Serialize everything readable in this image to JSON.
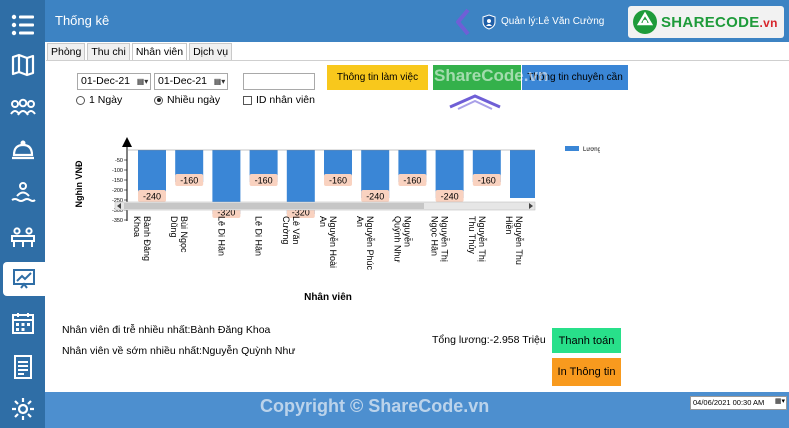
{
  "header": {
    "title": "Thống kê",
    "user_label": "Quản lý:Lê Văn Cường",
    "logo_text": "SHARECODE",
    "logo_suffix": ".vn"
  },
  "tabs": [
    {
      "label": "Phòng"
    },
    {
      "label": "Thu chi"
    },
    {
      "label": "Nhân viên"
    },
    {
      "label": "Dịch vụ"
    }
  ],
  "filters": {
    "date_from": "01-Dec-21",
    "date_to": "01-Dec-21",
    "id_value": "",
    "radio_one_day": "1 Ngày",
    "radio_many_days": "Nhiều ngày",
    "check_id": "ID nhân viên"
  },
  "buttons": {
    "work_info": "Thông tin làm việc",
    "green_btn": "Thông tin lương",
    "attendance": "Thông tin chuyên cần",
    "pay": "Thanh toán",
    "print": "In Thông tin"
  },
  "watermark": "ShareCode.vn",
  "notes": {
    "late": "Nhân viên đi trễ nhiều nhất:Bành Đăng Khoa",
    "early": "Nhân viên về sớm nhiều nhất:Nguyễn Quỳnh Như",
    "total": "Tổng lương:-2.958 Triệu"
  },
  "footer": {
    "copyright": "Copyright © ShareCode.vn",
    "datetime": "04/06/2021 00:30 AM"
  },
  "colors": {
    "sidebar": "#2f6ea6",
    "header": "#3d83c3",
    "bar": "#3a86d6",
    "label_bg": "#f9d2c0"
  },
  "chart_data": {
    "type": "bar",
    "xlabel": "Nhân viên",
    "ylabel": "Nghìn VNĐ",
    "legend": "Lương",
    "legend_position": "top-right",
    "yticks": [
      -50,
      -100,
      -150,
      -200,
      -250,
      -300,
      -350
    ],
    "ylim": [
      -350,
      0
    ],
    "categories": [
      "Bành Đăng Khoa",
      "Bùi Ngọc Dũng",
      "Lê Di Hân",
      "Lê Di Hân",
      "Lê Văn Cường",
      "Nguyễn Hoài An",
      "Nguyễn Phúc An",
      "Nguyễn Quỳnh Như",
      "Nguyễn Thị Ngọc Hân",
      "Nguyễn Thị Thu Thủy",
      "Nguyễn Thu Hiền"
    ],
    "values": [
      -240,
      -160,
      -320,
      -160,
      -320,
      -160,
      -240,
      -160,
      -240,
      -160,
      -240
    ],
    "labels": [
      "-240",
      "-160",
      "-320",
      "-160",
      "-320",
      "-160",
      "-240",
      "-160",
      "-240",
      "-160",
      ""
    ]
  }
}
